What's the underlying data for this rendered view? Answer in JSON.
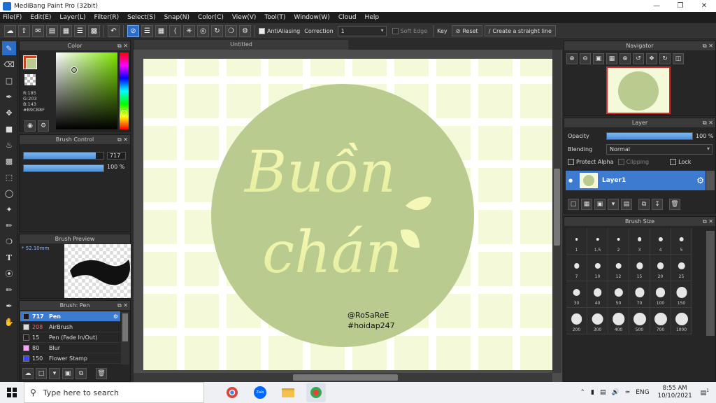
{
  "window": {
    "title": "MediBang Paint Pro (32bit)"
  },
  "menu": [
    "File(F)",
    "Edit(E)",
    "Layer(L)",
    "Filter(R)",
    "Select(S)",
    "Snap(N)",
    "Color(C)",
    "View(V)",
    "Tool(T)",
    "Window(W)",
    "Cloud",
    "Help"
  ],
  "toolbar": {
    "antialiasing_label": "AntiAliasing",
    "correction_label": "Correction",
    "correction_value": "1",
    "soft_edge_label": "Soft Edge",
    "key_label": "Key",
    "reset_label": "Reset",
    "straight_line_label": "Create a straight line"
  },
  "color_panel": {
    "title": "Color",
    "r": "R:185",
    "g": "G:203",
    "b": "B:143",
    "hex": "#B9CB8F",
    "main_color": "#b9cb8f"
  },
  "brush_control": {
    "title": "Brush Control",
    "size_value": "717",
    "size_fill": 0.9,
    "opacity_value": "100 %",
    "opacity_fill": 1.0
  },
  "brush_preview": {
    "title": "Brush Preview",
    "size_label": "* 52.10mm"
  },
  "brush_list": {
    "title": "Brush: Pen",
    "items": [
      {
        "size": "717",
        "name": "Pen",
        "color": "#1a1a1a",
        "selected": true
      },
      {
        "size": "208",
        "name": "AirBrush",
        "color": "#dddddd",
        "selected": false
      },
      {
        "size": "15",
        "name": "Pen (Fade In/Out)",
        "color": "#222222",
        "selected": false
      },
      {
        "size": "80",
        "name": "Blur",
        "color": "#f4a9f0",
        "selected": false
      },
      {
        "size": "150",
        "name": "Flower Stamp",
        "color": "#3a4cf0",
        "selected": false
      }
    ]
  },
  "document": {
    "tab_title": "Untitled",
    "canvas_bg": "#f3f9d9",
    "circle_color": "#b9cb8f",
    "text_line1": "Buồn",
    "text_line2": "chán",
    "credit_line1": "@RoSaReE",
    "credit_line2": "#hoidap247"
  },
  "navigator": {
    "title": "Navigator"
  },
  "layer_panel": {
    "title": "Layer",
    "opacity_label": "Opacity",
    "opacity_value": "100 %",
    "opacity_fill": 1.0,
    "blending_label": "Blending",
    "blending_value": "Normal",
    "protect_alpha": "Protect Alpha",
    "clipping": "Clipping",
    "lock": "Lock",
    "layer_name": "Layer1"
  },
  "brush_size_panel": {
    "title": "Brush Size",
    "sizes": [
      "1",
      "1.5",
      "2",
      "3",
      "4",
      "5",
      "7",
      "10",
      "12",
      "15",
      "20",
      "25",
      "30",
      "40",
      "50",
      "70",
      "100",
      "150",
      "200",
      "300",
      "400",
      "500",
      "700",
      "1000"
    ]
  },
  "taskbar": {
    "search_placeholder": "Type here to search",
    "lang": "ENG",
    "time": "8:55 AM",
    "date": "10/10/2021",
    "notif_count": "1"
  }
}
